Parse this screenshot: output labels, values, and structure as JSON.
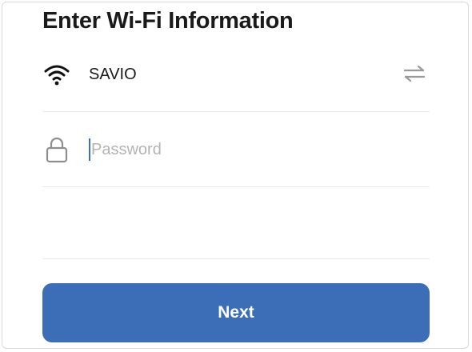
{
  "page": {
    "title": "Enter Wi-Fi Information"
  },
  "wifi": {
    "icon": "wifi-icon",
    "ssid": "SAVIO",
    "switch_icon": "swap-network-icon"
  },
  "password": {
    "icon": "lock-icon",
    "value": "",
    "placeholder": "Password"
  },
  "actions": {
    "next_label": "Next"
  },
  "colors": {
    "primary": "#3b6eb7",
    "caret": "#3b6fc0",
    "text": "#1a1a1a",
    "placeholder": "#b3b3b3",
    "icon_muted": "#8e8e8e"
  }
}
